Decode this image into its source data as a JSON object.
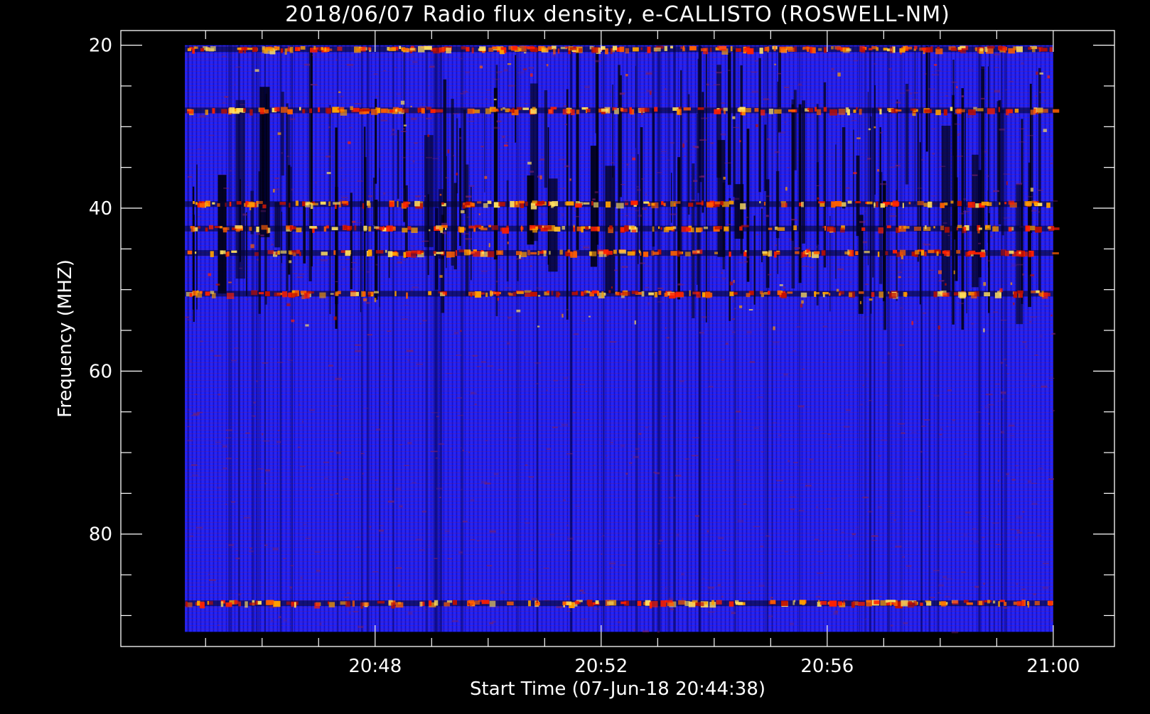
{
  "chart_data": {
    "type": "heatmap",
    "title": "2018/06/07  Radio flux density, e-CALLISTO (ROSWELL-NM)",
    "xlabel": "Start Time (07-Jun-18 20:44:38)",
    "ylabel": "Frequency (MHZ)",
    "x_start": "20:44:38",
    "x_end": "21:00:00",
    "xlim": [
      "20:43:30",
      "21:01:05"
    ],
    "ylim": [
      18.2,
      93.8
    ],
    "y_inverted": true,
    "xticks": [
      "20:48",
      "20:52",
      "20:56",
      "21:00"
    ],
    "xticks_minor": [
      "20:45",
      "20:46",
      "20:47",
      "20:48",
      "20:49",
      "20:50",
      "20:51",
      "20:52",
      "20:53",
      "20:54",
      "20:55",
      "20:56",
      "20:57",
      "20:58",
      "20:59",
      "21:00"
    ],
    "yticks": [
      20,
      40,
      60,
      80
    ],
    "yticks_minor": [
      20,
      25,
      30,
      35,
      40,
      45,
      50,
      55,
      60,
      65,
      70,
      75,
      80,
      85,
      90
    ],
    "freq_range_mhz": [
      20,
      92
    ],
    "colormap": [
      "#000000",
      "#1010a0",
      "#2020ff",
      "#8a1a6a",
      "#ff2000",
      "#ffa000",
      "#ffff80"
    ],
    "bright_bands_mhz": [
      20.5,
      28,
      39.5,
      42.5,
      45.5,
      50.5,
      88.5
    ],
    "dark_band_region_mhz": [
      20,
      55
    ]
  }
}
